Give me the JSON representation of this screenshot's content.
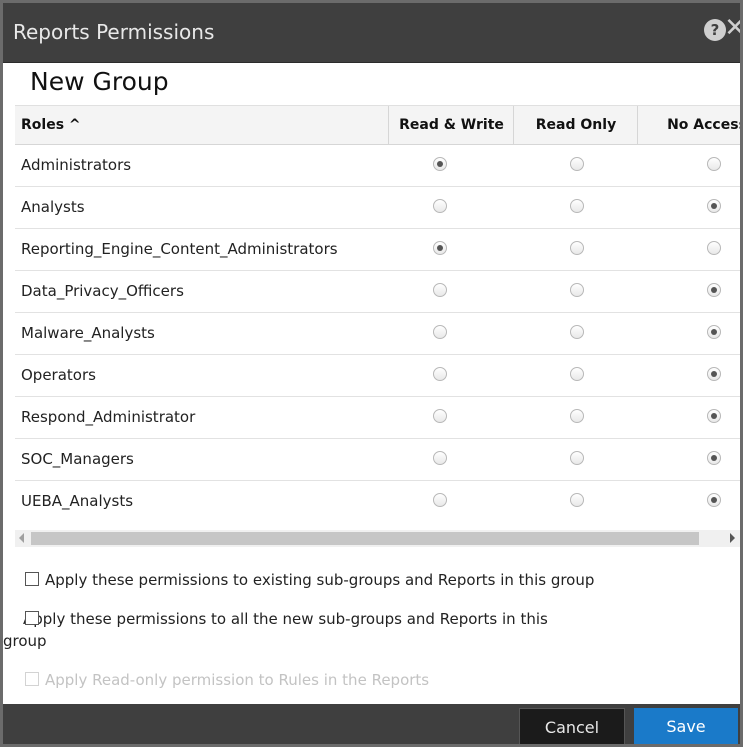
{
  "dialog": {
    "title": "Reports Permissions",
    "group_name": "New Group"
  },
  "table": {
    "columns": {
      "roles": "Roles ^",
      "read_write": "Read & Write",
      "read_only": "Read Only",
      "no_access": "No Access"
    },
    "rows": [
      {
        "name": "Administrators",
        "selected": "read_write"
      },
      {
        "name": "Analysts",
        "selected": "no_access"
      },
      {
        "name": "Reporting_Engine_Content_Administrators",
        "selected": "read_write"
      },
      {
        "name": "Data_Privacy_Officers",
        "selected": "no_access"
      },
      {
        "name": "Malware_Analysts",
        "selected": "no_access"
      },
      {
        "name": "Operators",
        "selected": "no_access"
      },
      {
        "name": "Respond_Administrator",
        "selected": "no_access"
      },
      {
        "name": "SOC_Managers",
        "selected": "no_access"
      },
      {
        "name": "UEBA_Analysts",
        "selected": "no_access"
      }
    ]
  },
  "options": {
    "apply_existing": "Apply these permissions to existing sub-groups and Reports in this group",
    "apply_new": "Apply these permissions to all the new sub-groups and Reports in this group",
    "apply_readonly_rules": "Apply Read-only permission to Rules in the Reports"
  },
  "footer": {
    "cancel_label": "Cancel",
    "save_label": "Save"
  },
  "colors": {
    "titlebar": "#3f3f3f",
    "save_button": "#1a7ac9",
    "cancel_button": "#1b1b1b"
  }
}
